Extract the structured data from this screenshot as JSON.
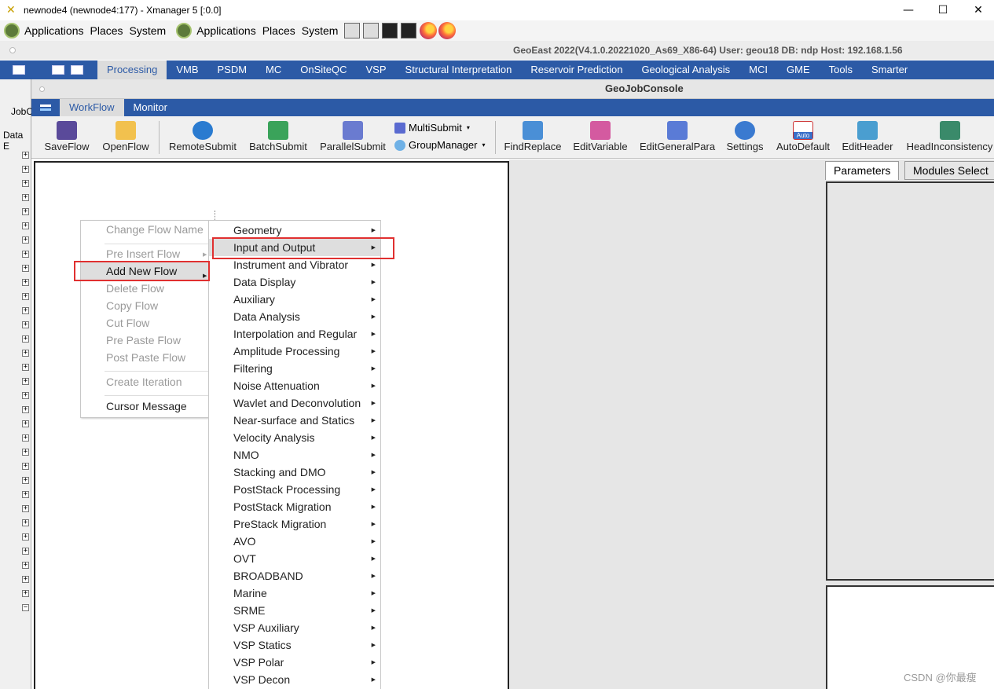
{
  "xmanager": {
    "title": "newnode4 (newnode4:177) - Xmanager 5 [:0.0]",
    "minimize": "—",
    "maximize": "☐",
    "close": "✕"
  },
  "gnome_panel": {
    "items": [
      "Applications",
      "Places",
      "System",
      "Applications",
      "Places",
      "System"
    ]
  },
  "geoeast_info": "GeoEast 2022(V4.1.0.20221020_As69_X86-64)   User: geou18    DB: ndp    Host: 192.168.1.56",
  "main_menu": {
    "items": [
      "Processing",
      "VMB",
      "PSDM",
      "MC",
      "OnSiteQC",
      "VSP",
      "Structural Interpretation",
      "Reservoir  Prediction",
      "Geological Analysis",
      "MCI",
      "GME",
      "Tools",
      "Smarter"
    ],
    "active": "Processing"
  },
  "left_strip": {
    "jobc_label": "JobC",
    "data_label": "Data E"
  },
  "console": {
    "title": "GeoJobConsole",
    "tabs": [
      "WorkFlow",
      "Monitor"
    ]
  },
  "toolbar": {
    "save_flow": "SaveFlow",
    "open_flow": "OpenFlow",
    "remote_submit": "RemoteSubmit",
    "batch_submit": "BatchSubmit",
    "parallel_submit": "ParallelSubmit",
    "multi_submit": "MultiSubmit",
    "group_manager": "GroupManager",
    "find_replace": "FindReplace",
    "edit_variable": "EditVariable",
    "edit_general_para": "EditGeneralPara",
    "settings": "Settings",
    "auto_default": "AutoDefault",
    "auto_badge": "Auto",
    "edit_header": "EditHeader",
    "head_inconsistency": "HeadInconsistency"
  },
  "right_panel": {
    "tabs": [
      "Parameters",
      "Modules Select"
    ]
  },
  "context_menu": {
    "change_flow_name": "Change Flow Name",
    "pre_insert_flow": "Pre Insert Flow",
    "add_new_flow": "Add New Flow",
    "delete_flow": "Delete Flow",
    "copy_flow": "Copy Flow",
    "cut_flow": "Cut Flow",
    "pre_paste_flow": "Pre Paste Flow",
    "post_paste_flow": "Post Paste Flow",
    "create_iteration": "Create Iteration",
    "cursor_message": "Cursor Message"
  },
  "submenu": {
    "items": [
      "Geometry",
      "Input and Output",
      "Instrument and Vibrator",
      "Data Display",
      "Auxiliary",
      "Data Analysis",
      "Interpolation and Regular",
      "Amplitude Processing",
      "Filtering",
      "Noise Attenuation",
      "Wavlet and Deconvolution",
      "Near-surface and Statics",
      "Velocity Analysis",
      "NMO",
      "Stacking and DMO",
      "PostStack Processing",
      "PostStack Migration",
      "PreStack Migration",
      "AVO",
      "OVT",
      "BROADBAND",
      "Marine",
      "SRME",
      "VSP Auxiliary",
      "VSP Statics",
      "VSP Polar",
      "VSP Decon"
    ],
    "highlighted": "Input and Output"
  },
  "watermark": "CSDN @你最瘦",
  "colors": {
    "menu_blue": "#2c5aa6",
    "highlight_red": "#e03030"
  }
}
